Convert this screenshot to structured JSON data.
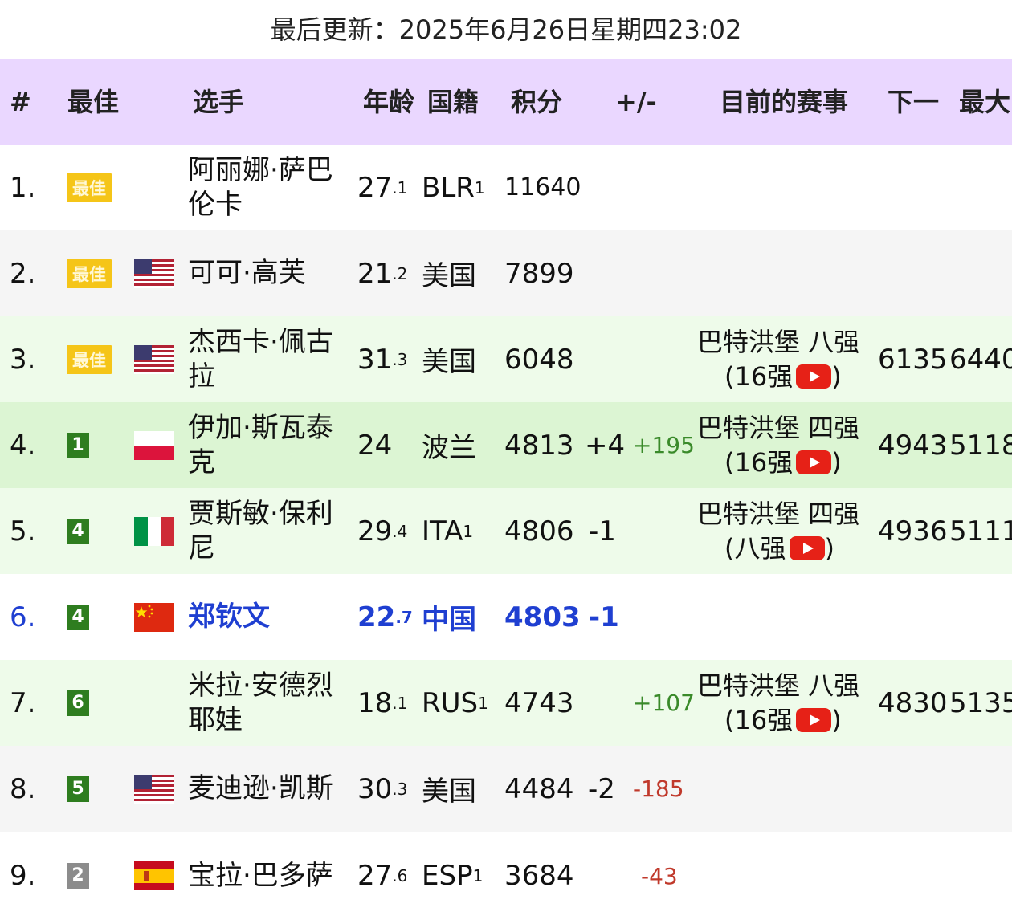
{
  "updated_text": "最后更新：2025年6月26日星期四23:02",
  "headers": {
    "hash": "#",
    "best": "最佳",
    "player": "选手",
    "age": "年龄",
    "nationality": "国籍",
    "points": "积分",
    "change": "+/-",
    "current_event": "目前的赛事",
    "next": "下一",
    "max": "最大"
  },
  "rows": [
    {
      "rank": "1.",
      "best": "最佳",
      "flag": "",
      "name": "阿丽娜·萨巴伦卡",
      "age": "27",
      "age_dec": ".1",
      "nat": "BLR",
      "nat_sup": "1",
      "points": "11640",
      "change": "",
      "gain": "",
      "event_line1": "",
      "event_line2": "",
      "next": "",
      "max": ""
    },
    {
      "rank": "2.",
      "best": "最佳",
      "flag": "usa-flag-icon",
      "name": "可可·高芙",
      "age": "21",
      "age_dec": ".2",
      "nat": "美国",
      "nat_sup": "",
      "points": "7899",
      "change": "",
      "gain": "",
      "event_line1": "",
      "event_line2": "",
      "next": "",
      "max": ""
    },
    {
      "rank": "3.",
      "best": "最佳",
      "flag": "usa-flag-icon",
      "name": "杰西卡·佩古拉",
      "age": "31",
      "age_dec": ".3",
      "nat": "美国",
      "nat_sup": "",
      "points": "6048",
      "change": "",
      "gain": "",
      "event_line1": "巴特洪堡 八强",
      "event_line2": "(16强",
      "next": "6135",
      "max": "6440"
    },
    {
      "rank": "4.",
      "best": "1",
      "flag": "poland-flag-icon",
      "name": "伊加·斯瓦泰克",
      "age": "24",
      "age_dec": "",
      "nat": "波兰",
      "nat_sup": "",
      "points": "4813",
      "change": "+4",
      "gain": "+195",
      "event_line1": "巴特洪堡 四强",
      "event_line2": "(16强",
      "next": "4943",
      "max": "5118"
    },
    {
      "rank": "5.",
      "best": "4",
      "flag": "italy-flag-icon",
      "name": "贾斯敏·保利尼",
      "age": "29",
      "age_dec": ".4",
      "nat": "ITA",
      "nat_sup": "1",
      "points": "4806",
      "change": "-1",
      "gain": "",
      "event_line1": "巴特洪堡 四强",
      "event_line2": "(八强",
      "next": "4936",
      "max": "5111"
    },
    {
      "rank": "6.",
      "best": "4",
      "flag": "china-flag-icon",
      "name": "郑钦文",
      "age": "22",
      "age_dec": ".7",
      "nat": "中国",
      "nat_sup": "",
      "points": "4803",
      "change": "-1",
      "gain": "",
      "event_line1": "",
      "event_line2": "",
      "next": "",
      "max": ""
    },
    {
      "rank": "7.",
      "best": "6",
      "flag": "",
      "name": "米拉·安德烈耶娃",
      "age": "18",
      "age_dec": ".1",
      "nat": "RUS",
      "nat_sup": "1",
      "points": "4743",
      "change": "",
      "gain": "+107",
      "event_line1": "巴特洪堡 八强",
      "event_line2": "(16强",
      "next": "4830",
      "max": "5135"
    },
    {
      "rank": "8.",
      "best": "5",
      "flag": "usa-flag-icon",
      "name": "麦迪逊·凯斯",
      "age": "30",
      "age_dec": ".3",
      "nat": "美国",
      "nat_sup": "",
      "points": "4484",
      "change": "-2",
      "gain": "-185",
      "event_line1": "",
      "event_line2": "",
      "next": "",
      "max": ""
    },
    {
      "rank": "9.",
      "best": "2",
      "flag": "spain-flag-icon",
      "name": "宝拉·巴多萨",
      "age": "27",
      "age_dec": ".6",
      "nat": "ESP",
      "nat_sup": "1",
      "points": "3684",
      "change": "",
      "gain": "-43",
      "event_line1": "",
      "event_line2": "",
      "next": "",
      "max": ""
    }
  ],
  "colors": {
    "header_bg": "#ead7ff",
    "row_alt_bg": "#f5f5f5",
    "row_green_light": "#eefbea",
    "row_green": "#dcf5d3",
    "highlight_text": "#1f3fd1",
    "best_badge": "#f5c518",
    "rank_badge_green": "#2e7d1f",
    "rank_badge_grey": "#8c8c8c",
    "positive": "#3a8a2a",
    "negative": "#c0392b"
  }
}
